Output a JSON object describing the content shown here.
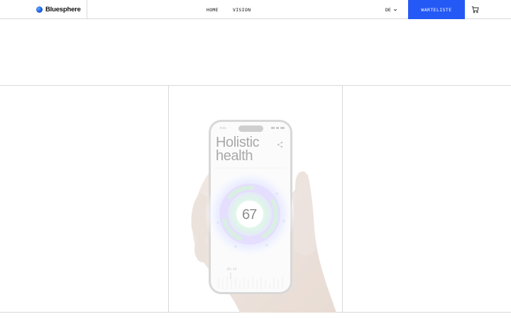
{
  "brand": {
    "name": "Bluesphere",
    "logo_icon": "sphere-logo-icon",
    "accent": "#2459f5"
  },
  "nav": {
    "home": "HOME",
    "vision": "VISION"
  },
  "language": {
    "current": "DE",
    "icon": "chevron-down-icon"
  },
  "cta": {
    "label": "WARTELISTE",
    "bg": "#2459f5"
  },
  "cart": {
    "icon": "cart-icon"
  },
  "hero": {
    "phone": {
      "status_time": "9:41",
      "title_line1": "Holistic",
      "title_line2": "health",
      "score": "67",
      "sub_label": "02:14"
    }
  }
}
